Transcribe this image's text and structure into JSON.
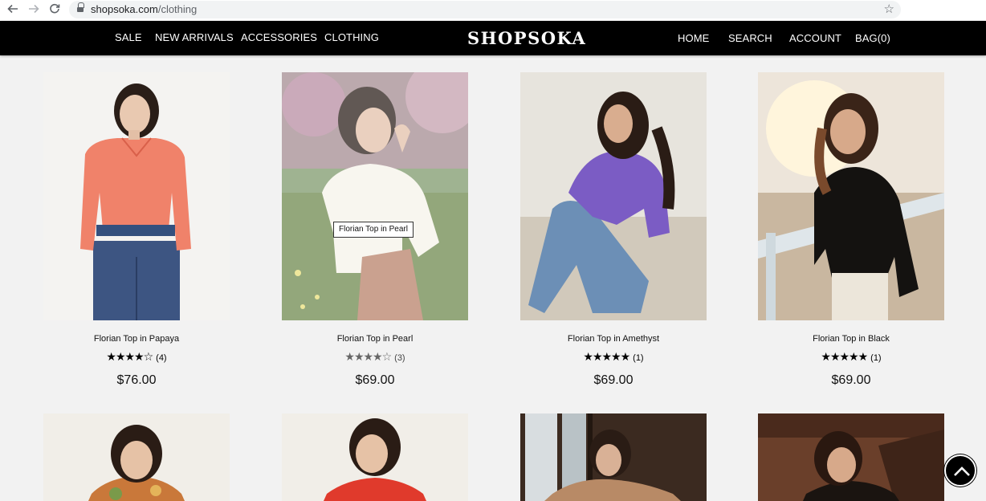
{
  "browser": {
    "url_host": "shopsoka.com",
    "url_path": "/clothing",
    "icons": [
      "back-arrow-icon",
      "forward-arrow-icon",
      "reload-icon",
      "lock-icon",
      "bookmark-star-icon"
    ]
  },
  "header": {
    "logo": "SHOPSOKA",
    "left_menu": [
      "SALE",
      "NEW ARRIVALS",
      "ACCESSORIES",
      "CLOTHING"
    ],
    "right_menu": [
      "HOME",
      "SEARCH",
      "ACCOUNT",
      "BAG(0)"
    ]
  },
  "products": [
    {
      "name": "Florian Top in Papaya",
      "stars": "★★★★☆",
      "review_count": "(4)",
      "price": "$76.00"
    },
    {
      "name": "Florian Top in Pearl",
      "stars": "★★★★☆",
      "review_count": "(3)",
      "price": "$69.00",
      "tooltip": "Florian Top in Pearl"
    },
    {
      "name": "Florian Top in Amethyst",
      "stars": "★★★★★",
      "review_count": "(1)",
      "price": "$69.00"
    },
    {
      "name": "Florian Top in Black",
      "stars": "★★★★★",
      "review_count": "(1)",
      "price": "$69.00"
    }
  ],
  "colors": {
    "page_background": "#f2f2f2",
    "header_background": "#000000",
    "header_text": "#ffffff",
    "papaya": "#f0826a",
    "amethyst": "#7b5cc4"
  },
  "scroll_top_icon": "chevron-up-icon"
}
